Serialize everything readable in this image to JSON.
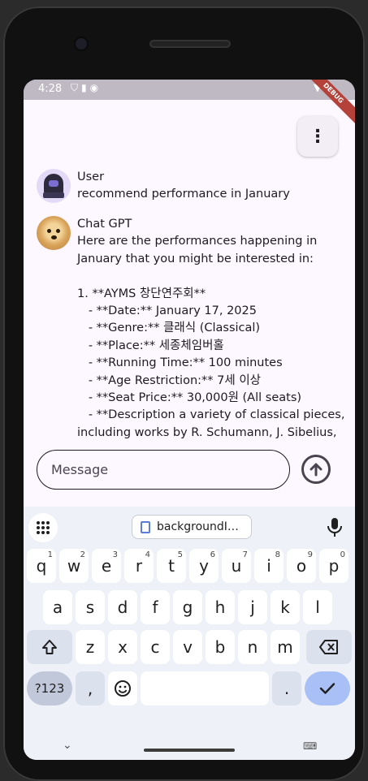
{
  "status_bar": {
    "time": "4:28",
    "debug_label": "DEBUG"
  },
  "chat": {
    "messages": [
      {
        "sender": "User",
        "text": "recommend performance in January"
      },
      {
        "sender": "Chat GPT",
        "text": "Here are the performances happening in January that you might be interested in:\n\n1. **AYMS 창단연주회**\n   - **Date:** January 17, 2025\n   - **Genre:** 클래식 (Classical)\n   - **Place:** 세종체임버홀\n   - **Running Time:** 100 minutes\n   - **Age Restriction:** 7세 이상\n   - **Seat Price:** 30,000원 (All seats)\n   - **Description a variety of classical pieces, including works by R. Schumann, J. Sibelius, S."
      }
    ]
  },
  "composer": {
    "placeholder": "Message"
  },
  "keyboard": {
    "clipboard_chip": "backgroundI…",
    "row1": [
      {
        "label": "q",
        "hint": "1"
      },
      {
        "label": "w",
        "hint": "2"
      },
      {
        "label": "e",
        "hint": "3"
      },
      {
        "label": "r",
        "hint": "4"
      },
      {
        "label": "t",
        "hint": "5"
      },
      {
        "label": "y",
        "hint": "6"
      },
      {
        "label": "u",
        "hint": "7"
      },
      {
        "label": "i",
        "hint": "8"
      },
      {
        "label": "o",
        "hint": "9"
      },
      {
        "label": "p",
        "hint": "0"
      }
    ],
    "row2": [
      "a",
      "s",
      "d",
      "f",
      "g",
      "h",
      "j",
      "k",
      "l"
    ],
    "row3": [
      "z",
      "x",
      "c",
      "v",
      "b",
      "n",
      "m"
    ],
    "row4": {
      "symbols": "?123",
      "comma": ",",
      "period": "."
    }
  }
}
